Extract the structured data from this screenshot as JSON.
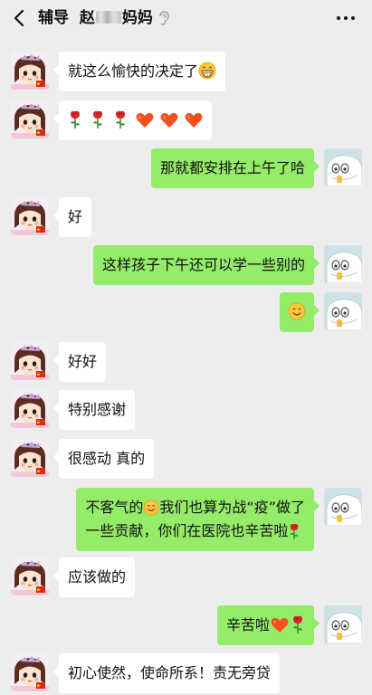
{
  "header": {
    "title_prefix": "辅导",
    "title_name_start": "赵",
    "title_name_end": "妈妈"
  },
  "messages": [
    {
      "side": "other",
      "text": "就这么愉快的决定了",
      "emoji": [
        "grin"
      ]
    },
    {
      "side": "other",
      "text": "",
      "emoji": [
        "rose",
        "rose",
        "rose",
        "heart",
        "heart",
        "heart"
      ]
    },
    {
      "side": "me",
      "text": "那就都安排在上午了哈",
      "emoji": []
    },
    {
      "side": "other",
      "text": "好",
      "emoji": []
    },
    {
      "side": "me",
      "text": "这样孩子下午还可以学一些别的",
      "emoji": []
    },
    {
      "side": "me",
      "text": "",
      "emoji": [
        "smile"
      ]
    },
    {
      "side": "other",
      "text": "好好",
      "emoji": []
    },
    {
      "side": "other",
      "text": "特别感谢",
      "emoji": []
    },
    {
      "side": "other",
      "text": "很感动 真的",
      "emoji": []
    },
    {
      "side": "me",
      "line1_a": "不客气的",
      "line1_b": "我们也算为战“疫”做了",
      "line2": "一些贡献，你们在医院也辛苦啦"
    },
    {
      "side": "other",
      "text": "应该做的",
      "emoji": []
    },
    {
      "side": "me",
      "text": "辛苦啦",
      "emoji": [
        "heart",
        "rose"
      ]
    },
    {
      "side": "other",
      "text": "初心使然，使命所系！责无旁贷",
      "emoji": []
    }
  ],
  "icons": [
    "back-arrow-icon",
    "ear-icon",
    "more-icon",
    "avatar-girl",
    "avatar-ghost"
  ],
  "colors": {
    "background": "#ededed",
    "my_bubble": "#95ec69",
    "their_bubble": "#ffffff"
  }
}
